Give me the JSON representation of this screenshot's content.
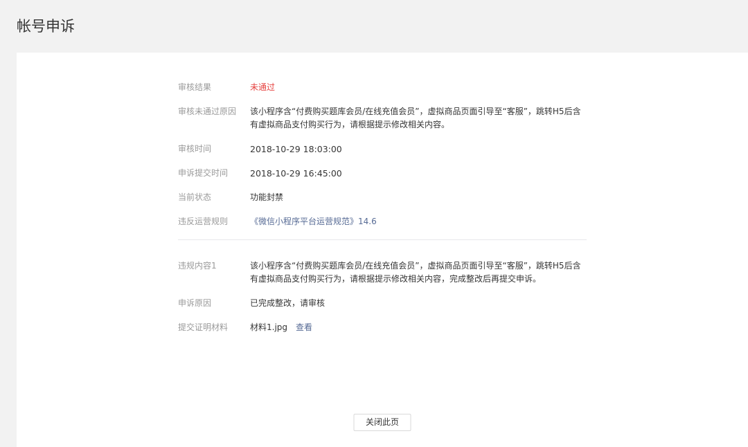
{
  "page": {
    "title": "帐号申诉"
  },
  "details": {
    "result": {
      "label": "审核结果",
      "value": "未通过"
    },
    "reason": {
      "label": "审核未通过原因",
      "lines": [
        "该小程序含“付费购买题库会员/在线充值会员”，虚拟商品页面引导至“客服”，跳转H5后含",
        "有虚拟商品支付购买行为，请根据提示修改相关内容。"
      ]
    },
    "review_time": {
      "label": "审核时间",
      "value": "2018-10-29 18:03:00"
    },
    "submit_time": {
      "label": "申诉提交时间",
      "value": "2018-10-29 16:45:00"
    },
    "status": {
      "label": "当前状态",
      "value": "功能封禁"
    },
    "rule": {
      "label": "违反运营规则",
      "value": "《微信小程序平台运营规范》14.6"
    }
  },
  "appeal": {
    "violation": {
      "label": "违规内容1",
      "lines": [
        "该小程序含“付费购买题库会员/在线充值会员”，虚拟商品页面引导至“客服”，跳转H5后含",
        "有虚拟商品支付购买行为，请根据提示修改相关内容，完成整改后再提交申诉。"
      ]
    },
    "appeal_reason": {
      "label": "申诉原因",
      "value": "已完成整改，请审核"
    },
    "evidence": {
      "label": "提交证明材料",
      "file": "材料1.jpg",
      "view_link": "查看"
    }
  },
  "actions": {
    "close_button": "关闭此页"
  },
  "colors": {
    "rejected": "#e64340",
    "link": "#576b95",
    "label": "#9a9a9a",
    "text": "#353535",
    "background": "#f2f2f2"
  }
}
